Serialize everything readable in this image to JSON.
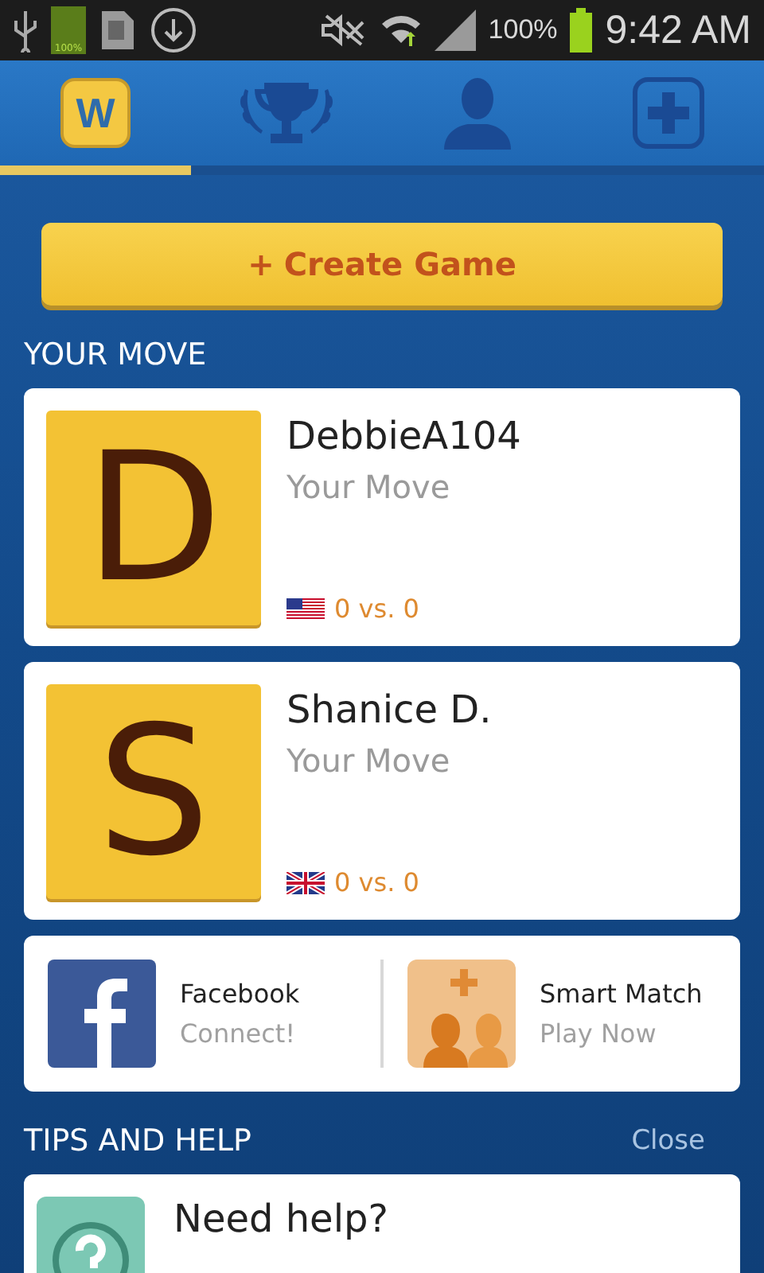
{
  "status_bar": {
    "battery_badge": "100%",
    "battery_percent": "100%",
    "time": "9:42 AM"
  },
  "tabs": [
    {
      "kind": "logo",
      "label": "W",
      "selected": true
    },
    {
      "kind": "trophy",
      "selected": false
    },
    {
      "kind": "profile",
      "selected": false
    },
    {
      "kind": "add",
      "selected": false
    }
  ],
  "create_button": {
    "icon": "+",
    "label": "Create Game"
  },
  "your_move": {
    "heading": "YOUR MOVE",
    "games": [
      {
        "letter": "D",
        "name": "DebbieA104",
        "status": "Your Move",
        "kind": "us",
        "score": "0 vs. 0"
      },
      {
        "letter": "S",
        "name": "Shanice D.",
        "status": "Your Move",
        "kind": "uk",
        "score": "0 vs. 0"
      }
    ]
  },
  "actions": [
    {
      "kind": "facebook",
      "title": "Facebook",
      "subtitle": "Connect!"
    },
    {
      "kind": "smart_match",
      "title": "Smart Match",
      "subtitle": "Play Now"
    }
  ],
  "tips": {
    "heading": "TIPS AND HELP",
    "close": "Close",
    "card": {
      "title": "Need help?"
    }
  }
}
